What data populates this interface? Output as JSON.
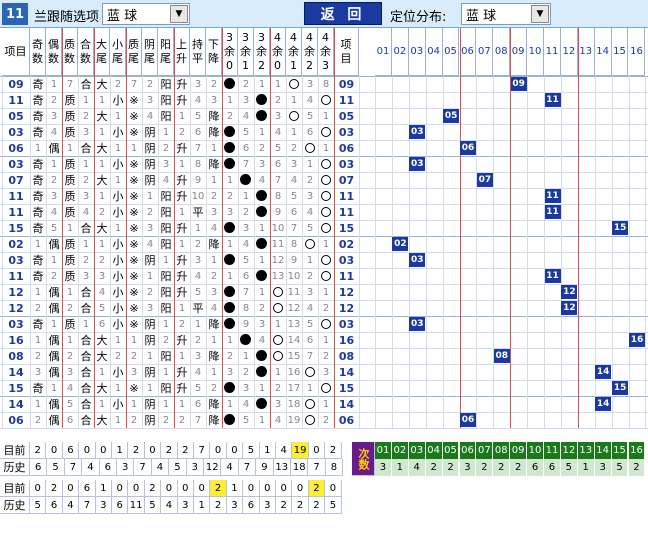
{
  "header": {
    "issue": "11",
    "follow_label": "兰跟随选项",
    "follow_value": "蓝    球",
    "back_label": "返 回",
    "pos_label": "定位分布:",
    "pos_value": "蓝    球"
  },
  "columns": [
    "项目",
    "奇数",
    "偶数",
    "质数",
    "合数",
    "大尾",
    "小尾",
    "质尾",
    "阴尾",
    "阳尾",
    "上升",
    "持平",
    "下降",
    "3余0",
    "3余1",
    "3余2",
    "4余0",
    "4余1",
    "4余2",
    "4余3",
    "项目"
  ],
  "dist_cols": [
    "01",
    "02",
    "03",
    "04",
    "05",
    "06",
    "07",
    "08",
    "09",
    "10",
    "11",
    "12",
    "13",
    "14",
    "15",
    "16"
  ],
  "rows": [
    {
      "n": "09",
      "c": [
        "奇",
        "1",
        "7",
        "合",
        "大",
        "2",
        "7",
        "2",
        "阳",
        "升",
        "3",
        "2",
        "●",
        "2",
        "1",
        "1",
        "◎",
        "3",
        "8"
      ]
    },
    {
      "n": "11",
      "c": [
        "奇",
        "2",
        "质",
        "1",
        "1",
        "小",
        "※",
        "3",
        "阳",
        "升",
        "4",
        "3",
        "1",
        "3",
        "●",
        "2",
        "1",
        "4",
        "◎"
      ]
    },
    {
      "n": "05",
      "c": [
        "奇",
        "3",
        "质",
        "2",
        "大",
        "1",
        "※",
        "4",
        "阳",
        "1",
        "5",
        "降",
        "2",
        "4",
        "●",
        "3",
        "◎",
        "5",
        "1"
      ]
    },
    {
      "n": "03",
      "c": [
        "奇",
        "4",
        "质",
        "3",
        "1",
        "小",
        "※",
        "阴",
        "1",
        "2",
        "6",
        "降",
        "●",
        "5",
        "1",
        "4",
        "1",
        "6",
        "◎"
      ]
    },
    {
      "n": "06",
      "c": [
        "1",
        "偶",
        "1",
        "合",
        "大",
        "1",
        "1",
        "阴",
        "2",
        "升",
        "7",
        "1",
        "●",
        "6",
        "2",
        "5",
        "2",
        "◎",
        "1"
      ]
    },
    {
      "n": "03",
      "c": [
        "奇",
        "1",
        "质",
        "1",
        "1",
        "小",
        "※",
        "阴",
        "3",
        "1",
        "8",
        "降",
        "●",
        "7",
        "3",
        "6",
        "3",
        "1",
        "◎"
      ]
    },
    {
      "n": "07",
      "c": [
        "奇",
        "2",
        "质",
        "2",
        "大",
        "1",
        "※",
        "阴",
        "4",
        "升",
        "9",
        "1",
        "1",
        "●",
        "4",
        "7",
        "4",
        "2",
        "◎"
      ]
    },
    {
      "n": "11",
      "c": [
        "奇",
        "3",
        "质",
        "3",
        "1",
        "小",
        "※",
        "1",
        "阳",
        "升",
        "10",
        "2",
        "2",
        "1",
        "●",
        "8",
        "5",
        "3",
        "◎"
      ]
    },
    {
      "n": "11",
      "c": [
        "奇",
        "4",
        "质",
        "4",
        "2",
        "小",
        "※",
        "2",
        "阳",
        "1",
        "平",
        "3",
        "3",
        "2",
        "●",
        "9",
        "6",
        "4",
        "◎"
      ]
    },
    {
      "n": "15",
      "c": [
        "奇",
        "5",
        "1",
        "合",
        "大",
        "1",
        "※",
        "3",
        "阳",
        "升",
        "1",
        "4",
        "●",
        "3",
        "1",
        "10",
        "7",
        "5",
        "◎"
      ]
    },
    {
      "n": "02",
      "c": [
        "1",
        "偶",
        "质",
        "1",
        "1",
        "小",
        "※",
        "4",
        "阳",
        "1",
        "2",
        "降",
        "1",
        "4",
        "●",
        "11",
        "8",
        "◎",
        "1"
      ]
    },
    {
      "n": "03",
      "c": [
        "奇",
        "1",
        "质",
        "2",
        "2",
        "小",
        "※",
        "阴",
        "1",
        "升",
        "3",
        "1",
        "●",
        "5",
        "1",
        "12",
        "9",
        "1",
        "◎"
      ]
    },
    {
      "n": "11",
      "c": [
        "奇",
        "2",
        "质",
        "3",
        "3",
        "小",
        "※",
        "1",
        "阳",
        "升",
        "4",
        "2",
        "1",
        "6",
        "●",
        "13",
        "10",
        "2",
        "◎"
      ]
    },
    {
      "n": "12",
      "c": [
        "1",
        "偶",
        "1",
        "合",
        "4",
        "小",
        "※",
        "2",
        "阳",
        "升",
        "5",
        "3",
        "●",
        "7",
        "1",
        "◎",
        "11",
        "3",
        "1"
      ]
    },
    {
      "n": "12",
      "c": [
        "2",
        "偶",
        "2",
        "合",
        "5",
        "小",
        "※",
        "3",
        "阳",
        "1",
        "平",
        "4",
        "●",
        "8",
        "2",
        "◎",
        "12",
        "4",
        "2"
      ]
    },
    {
      "n": "03",
      "c": [
        "奇",
        "1",
        "质",
        "1",
        "6",
        "小",
        "※",
        "阴",
        "1",
        "2",
        "1",
        "降",
        "●",
        "9",
        "3",
        "1",
        "13",
        "5",
        "◎"
      ]
    },
    {
      "n": "16",
      "c": [
        "1",
        "偶",
        "1",
        "合",
        "大",
        "1",
        "1",
        "阴",
        "2",
        "升",
        "2",
        "1",
        "1",
        "●",
        "4",
        "◎",
        "14",
        "6",
        "1"
      ]
    },
    {
      "n": "08",
      "c": [
        "2",
        "偶",
        "2",
        "合",
        "大",
        "2",
        "2",
        "1",
        "阳",
        "1",
        "3",
        "降",
        "2",
        "1",
        "●",
        "◎",
        "15",
        "7",
        "2"
      ]
    },
    {
      "n": "14",
      "c": [
        "3",
        "偶",
        "3",
        "合",
        "1",
        "小",
        "3",
        "阴",
        "1",
        "升",
        "4",
        "1",
        "3",
        "2",
        "●",
        "1",
        "16",
        "◎",
        "3"
      ]
    },
    {
      "n": "15",
      "c": [
        "奇",
        "1",
        "4",
        "合",
        "大",
        "1",
        "※",
        "1",
        "阳",
        "升",
        "5",
        "2",
        "●",
        "3",
        "1",
        "2",
        "17",
        "1",
        "◎"
      ]
    },
    {
      "n": "14",
      "c": [
        "1",
        "偶",
        "5",
        "合",
        "1",
        "小",
        "1",
        "阴",
        "1",
        "1",
        "6",
        "降",
        "1",
        "4",
        "●",
        "3",
        "18",
        "◎",
        "1"
      ]
    },
    {
      "n": "06",
      "c": [
        "2",
        "偶",
        "6",
        "合",
        "大",
        "1",
        "2",
        "阴",
        "2",
        "2",
        "7",
        "降",
        "●",
        "5",
        "1",
        "4",
        "19",
        "◎",
        "2"
      ]
    }
  ],
  "current_row": [
    "2",
    "0",
    "6",
    "0",
    "0",
    "1",
    "2",
    "0",
    "2",
    "2",
    "7",
    "0",
    "0",
    "5",
    "1",
    "4",
    "19",
    "0",
    "2"
  ],
  "history_row": [
    "6",
    "5",
    "7",
    "4",
    "6",
    "3",
    "7",
    "4",
    "5",
    "3",
    "12",
    "4",
    "7",
    "9",
    "13",
    "18",
    "7",
    "8"
  ],
  "cishu_label": "次数",
  "dist_current": [
    "01",
    "02",
    "03",
    "04",
    "05",
    "06",
    "07",
    "08",
    "09",
    "10",
    "11",
    "12",
    "13",
    "14",
    "15",
    "16"
  ],
  "dist_history": [
    "3",
    "1",
    "4",
    "2",
    "2",
    "3",
    "2",
    "2",
    "2",
    "6",
    "6",
    "5",
    "1",
    "3",
    "5",
    "2"
  ],
  "bottom_current": [
    "0",
    "2",
    "0",
    "6",
    "1",
    "0",
    "0",
    "2",
    "0",
    "0",
    "0",
    "2",
    "1",
    "0",
    "0",
    "0",
    "0",
    "2",
    "0"
  ],
  "bottom_history": [
    "5",
    "6",
    "4",
    "7",
    "3",
    "6",
    "11",
    "5",
    "4",
    "3",
    "1",
    "2",
    "3",
    "6",
    "3",
    "2",
    "2",
    "2",
    "5"
  ],
  "labels": {
    "current": "目前",
    "history": "历史"
  },
  "colors": {
    "accent": "#1a3aa0",
    "highlight": "#ffee33",
    "green": "#1a7a1a"
  }
}
